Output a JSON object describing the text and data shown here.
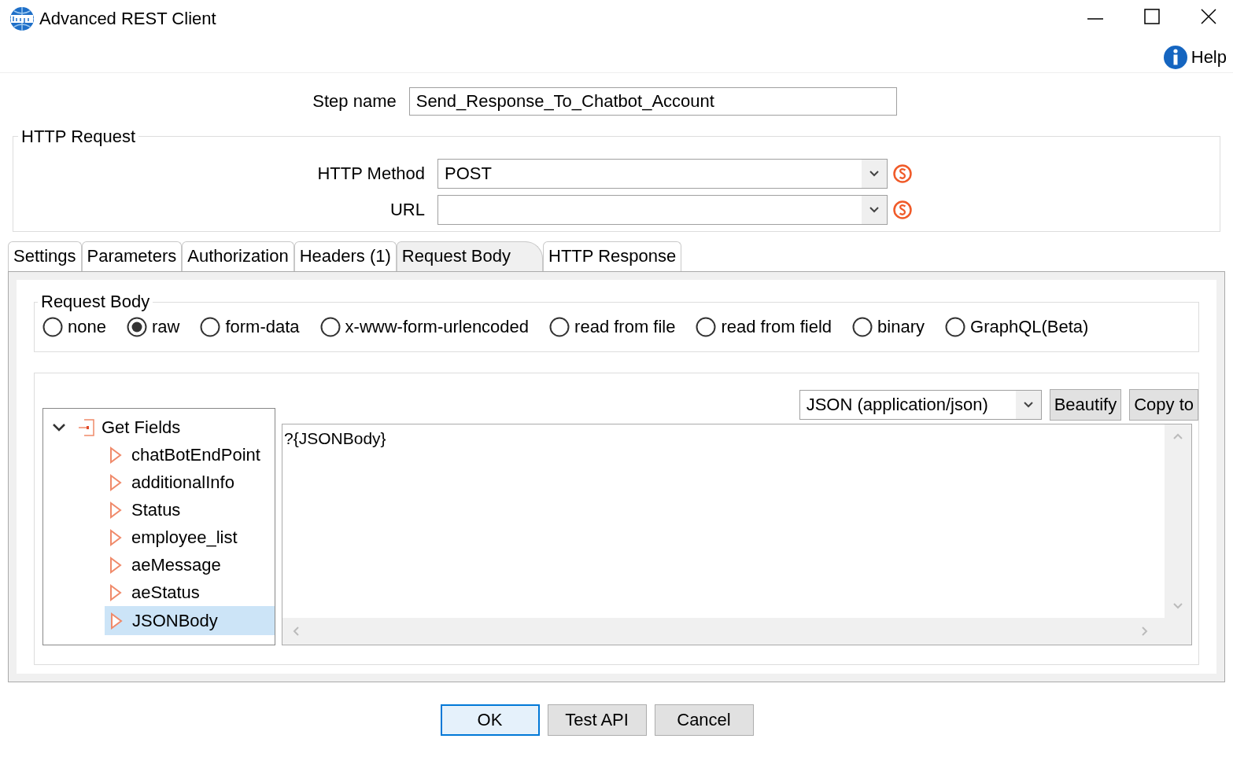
{
  "window": {
    "title": "Advanced REST Client"
  },
  "help": {
    "label": "Help"
  },
  "step_name": {
    "label": "Step name",
    "value": "Send_Response_To_Chatbot_Account"
  },
  "http_request": {
    "title": "HTTP Request",
    "method": {
      "label": "HTTP Method",
      "value": "POST"
    },
    "url": {
      "label": "URL"
    }
  },
  "tabs": [
    {
      "label": "Settings",
      "selected": false
    },
    {
      "label": "Parameters",
      "selected": false
    },
    {
      "label": "Authorization",
      "selected": false
    },
    {
      "label": "Headers (1)",
      "selected": false
    },
    {
      "label": "Request Body",
      "selected": true
    },
    {
      "label": "HTTP Response",
      "selected": false
    }
  ],
  "request_body": {
    "title": "Request Body",
    "options": [
      {
        "label": "none",
        "selected": false
      },
      {
        "label": "raw",
        "selected": true
      },
      {
        "label": "form-data",
        "selected": false
      },
      {
        "label": "x-www-form-urlencoded",
        "selected": false
      },
      {
        "label": "read from file",
        "selected": false
      },
      {
        "label": "read from field",
        "selected": false
      },
      {
        "label": "binary",
        "selected": false
      },
      {
        "label": "GraphQL(Beta)",
        "selected": false
      }
    ]
  },
  "tree": {
    "label": "Get Fields",
    "expanded": true,
    "children": [
      {
        "label": "chatBotEndPoint",
        "selected": false
      },
      {
        "label": "additionalInfo",
        "selected": false
      },
      {
        "label": "Status",
        "selected": false
      },
      {
        "label": "employee_list",
        "selected": false
      },
      {
        "label": "aeMessage",
        "selected": false
      },
      {
        "label": "aeStatus",
        "selected": false
      },
      {
        "label": "JSONBody",
        "selected": true
      }
    ]
  },
  "content_type": {
    "value": "JSON (application/json)"
  },
  "editor_buttons": [
    "Beautify",
    "Copy to"
  ],
  "editor": {
    "value": "?{JSONBody}"
  },
  "buttons": [
    {
      "label": "OK",
      "default": true
    },
    {
      "label": "Test API",
      "default": false
    },
    {
      "label": "Cancel",
      "default": false
    }
  ]
}
